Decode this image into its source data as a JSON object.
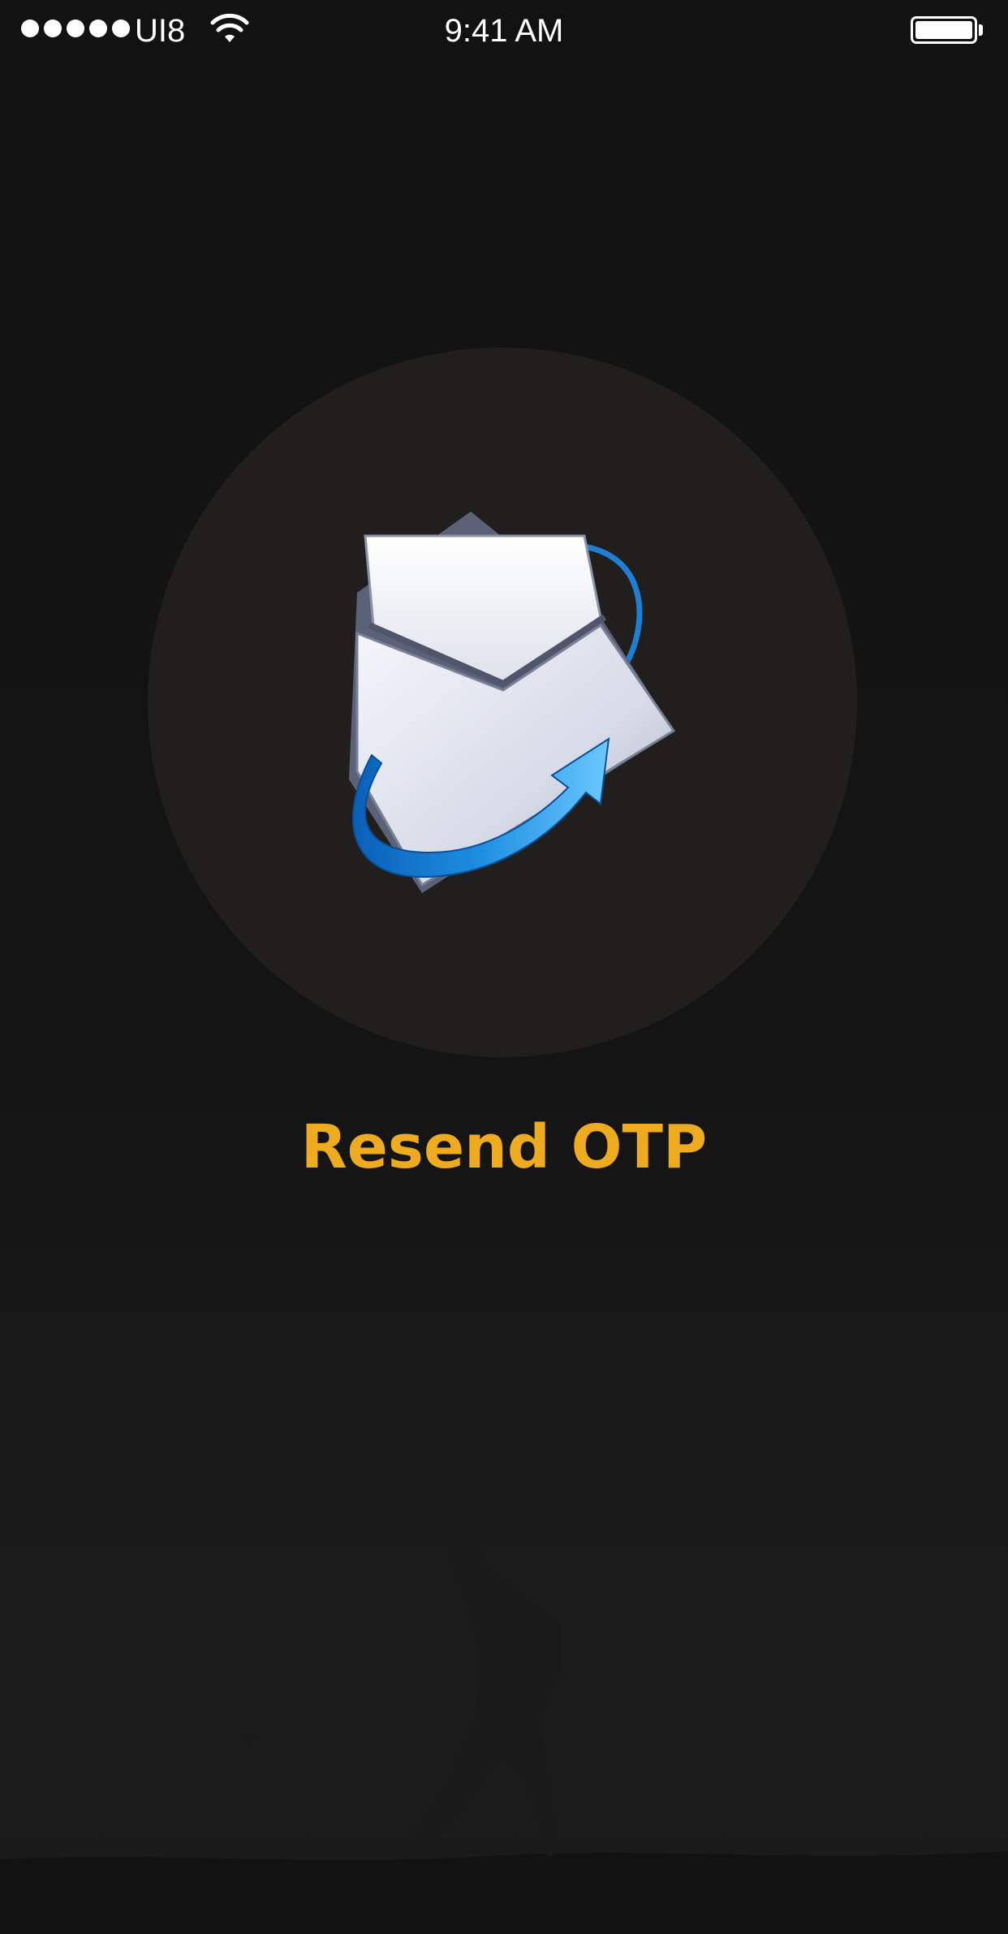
{
  "status_bar": {
    "carrier": "UI8",
    "time": "9:41 AM",
    "battery_level": 1.0
  },
  "main": {
    "illustration_icon": "mail-resend-icon",
    "action_label": "Resend OTP"
  },
  "colors": {
    "background": "#141414",
    "circle": "#201f1e",
    "accent": "#eeab20",
    "arrow_blue": "#1e8fe0"
  }
}
